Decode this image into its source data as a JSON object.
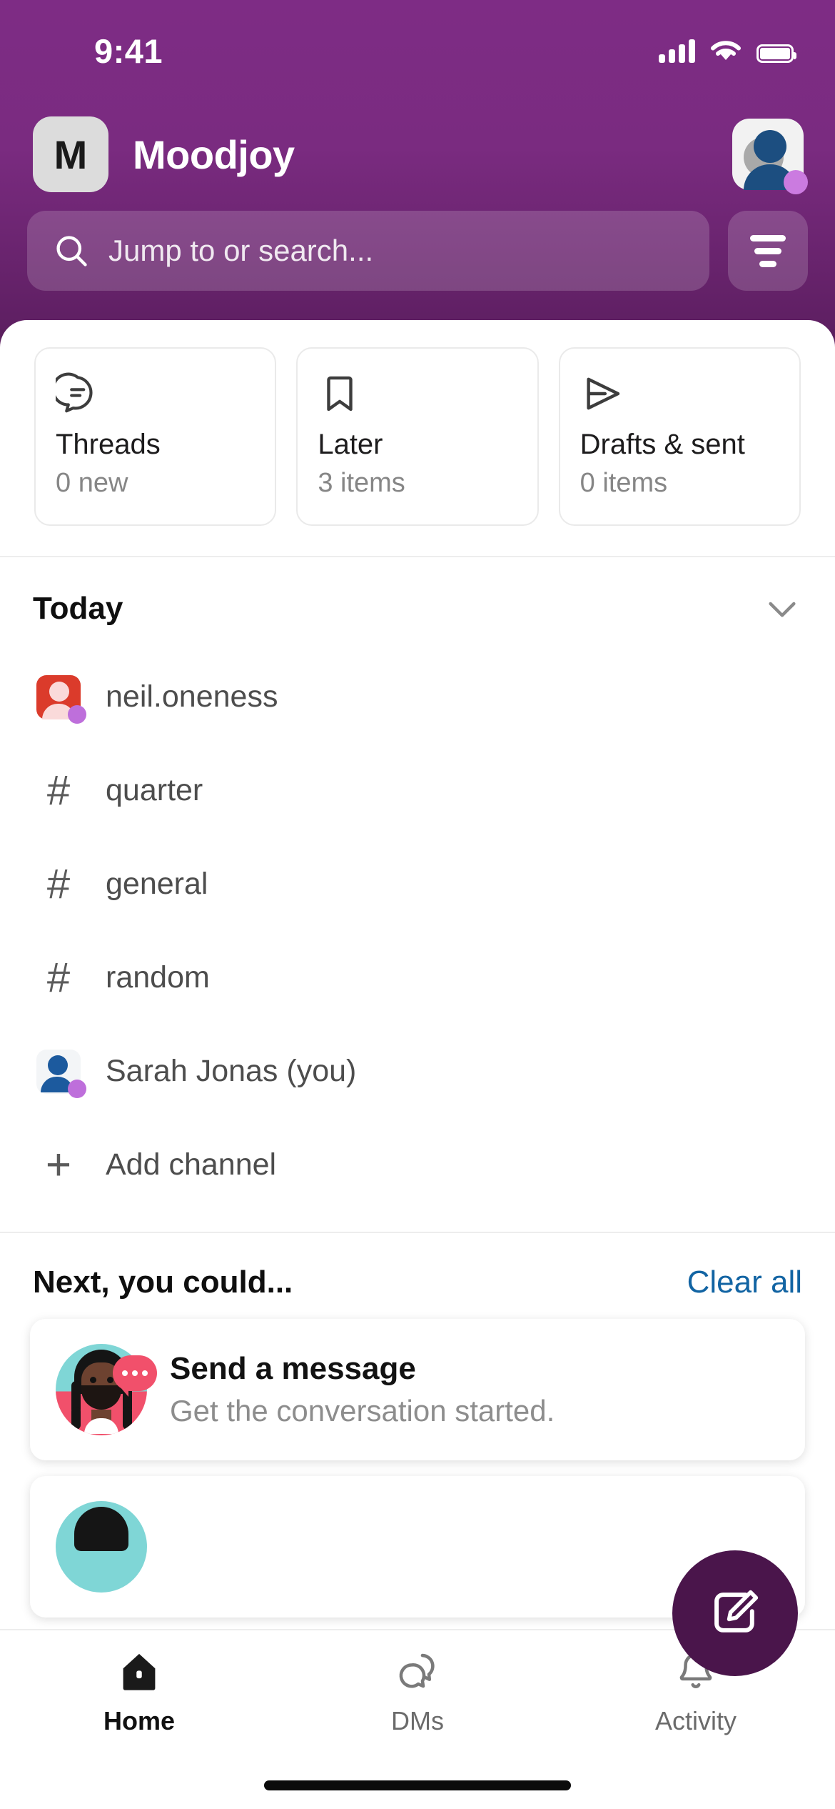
{
  "status_bar": {
    "time": "9:41",
    "cellular_icon": "cellular-signal-icon",
    "wifi_icon": "wifi-icon",
    "battery_icon": "battery-icon"
  },
  "header": {
    "workspace_initial": "M",
    "workspace_name": "Moodjoy",
    "avatar_icon": "user-avatar",
    "avatar_presence": "presence-dot",
    "background_color": "#7A2B80"
  },
  "search": {
    "placeholder": "Jump to or search...",
    "value": "",
    "search_icon": "search-icon",
    "filter_icon": "filter-icon"
  },
  "quick_cards": [
    {
      "icon": "threads-icon",
      "title": "Threads",
      "subtitle": "0 new"
    },
    {
      "icon": "bookmark-icon",
      "title": "Later",
      "subtitle": "3 items"
    },
    {
      "icon": "paper-plane-icon",
      "title": "Drafts & sent",
      "subtitle": "0 items"
    }
  ],
  "today_section": {
    "label": "Today",
    "collapse_icon": "chevron-down-icon",
    "items": [
      {
        "type": "dm",
        "icon": "avatar-red",
        "label": "neil.oneness"
      },
      {
        "type": "channel",
        "icon": "hash-icon",
        "label": "quarter"
      },
      {
        "type": "channel",
        "icon": "hash-icon",
        "label": "general"
      },
      {
        "type": "channel",
        "icon": "hash-icon",
        "label": "random"
      },
      {
        "type": "dm",
        "icon": "avatar-self",
        "label": "Sarah Jonas (you)"
      },
      {
        "type": "action",
        "icon": "plus-icon",
        "label": "Add channel"
      }
    ]
  },
  "next_section": {
    "label": "Next, you could...",
    "clear_label": "Clear all",
    "clear_color": "#1264A3",
    "suggestions": [
      {
        "avatar": "person-illustration",
        "title": "Send a message",
        "subtitle": "Get the conversation started."
      }
    ]
  },
  "compose_fab": {
    "icon": "compose-icon",
    "color": "#4A154B"
  },
  "tabbar": {
    "items": [
      {
        "icon": "home-icon",
        "label": "Home",
        "active": true
      },
      {
        "icon": "dms-icon",
        "label": "DMs",
        "active": false
      },
      {
        "icon": "bell-icon",
        "label": "Activity",
        "active": false
      }
    ]
  }
}
